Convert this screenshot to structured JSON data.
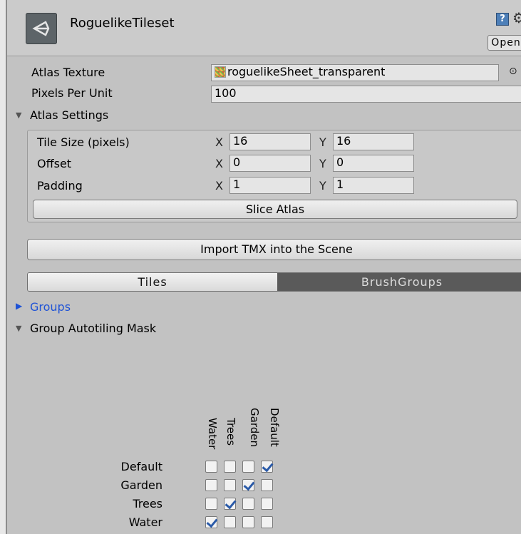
{
  "header": {
    "title": "RoguelikeTileset",
    "open_button": "Open",
    "icons": [
      "unity-asset-icon",
      "help-icon",
      "gear-icon"
    ]
  },
  "fields": {
    "atlas_texture": {
      "label": "Atlas Texture",
      "value": "roguelikeSheet_transparent"
    },
    "pixels_per_unit": {
      "label": "Pixels Per Unit",
      "value": "100"
    }
  },
  "atlas_settings": {
    "label": "Atlas Settings",
    "x_axis": "X",
    "y_axis": "Y",
    "rows": [
      {
        "label": "Tile Size (pixels)",
        "x": "16",
        "y": "16"
      },
      {
        "label": "Offset",
        "x": "0",
        "y": "0"
      },
      {
        "label": "Padding",
        "x": "1",
        "y": "1"
      }
    ],
    "slice_button": "Slice Atlas"
  },
  "import_button": "Import TMX into the Scene",
  "tabs": [
    {
      "label": "Tiles",
      "active": true
    },
    {
      "label": "BrushGroups",
      "active": false
    }
  ],
  "groups_label": "Groups",
  "mask": {
    "label": "Group Autotiling Mask",
    "columns": [
      "Water",
      "Trees",
      "Garden",
      "Default"
    ],
    "rows": [
      {
        "label": "Default",
        "checked": [
          false,
          false,
          false,
          true
        ]
      },
      {
        "label": "Garden",
        "checked": [
          false,
          false,
          true,
          false
        ]
      },
      {
        "label": "Trees",
        "checked": [
          false,
          true,
          false,
          false
        ]
      },
      {
        "label": "Water",
        "checked": [
          true,
          false,
          false,
          false
        ]
      }
    ]
  },
  "colors": {
    "background": "#c2c2c2",
    "link_blue": "#1f53d6",
    "check_blue": "#2a5aa8",
    "active_tab_dark": "#5a5a5a"
  }
}
